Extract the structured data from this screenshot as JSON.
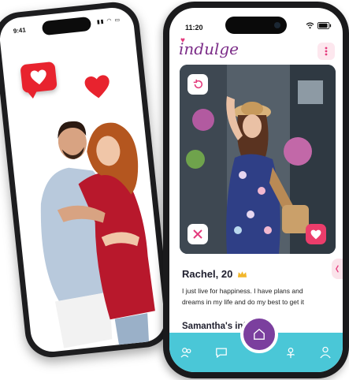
{
  "back_phone": {
    "time": "9:41"
  },
  "front_phone": {
    "time": "11:20",
    "app_logo": "indulge",
    "profile": {
      "name_age": "Rachel, 20",
      "bio": "I just live for happiness. I have plans and dreams in my life and do my best to get it",
      "info_heading": "Samantha's info"
    },
    "nav": [
      "people-icon",
      "chat-icon",
      "home-icon",
      "flower-icon",
      "profile-icon"
    ]
  },
  "colors": {
    "brand_purple": "#7b2c88",
    "teal_nav": "#4ac7d7",
    "like_pink": "#ec3d6b",
    "badge_red": "#e8232e"
  }
}
